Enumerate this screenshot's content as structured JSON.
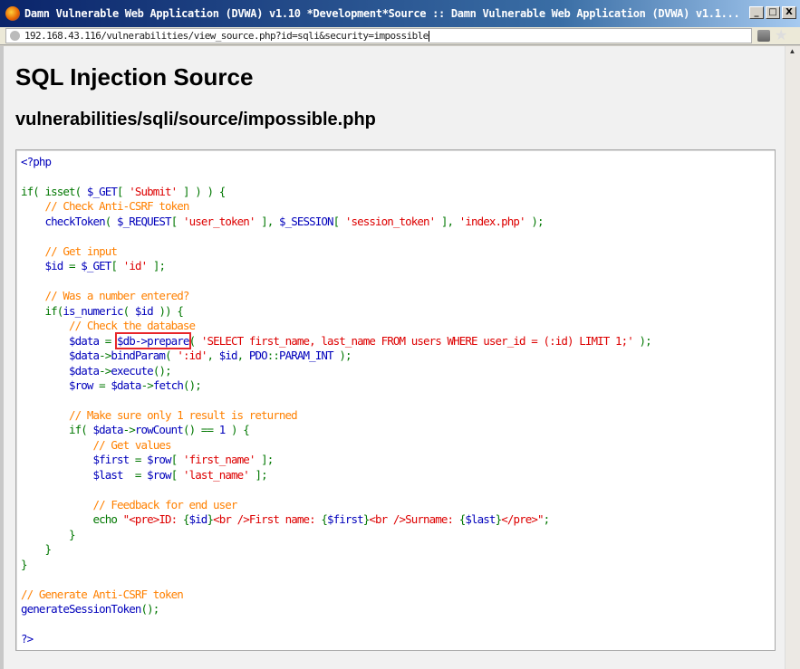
{
  "window": {
    "title": "Damn Vulnerable Web Application (DVWA) v1.10 *Development*Source :: Damn Vulnerable Web Application (DVWA) v1.1...",
    "minimize": "_",
    "maximize": "□",
    "close": "X"
  },
  "address_bar": {
    "url": "192.168.43.116/vulnerabilities/view_source.php?id=sqli&security=impossible"
  },
  "page": {
    "title": "SQL Injection Source",
    "subtitle": "vulnerabilities/sqli/source/impossible.php"
  },
  "colors": {
    "keyword": "#007700",
    "variable": "#0000bb",
    "string": "#dd0000",
    "comment": "#ff8000",
    "highlight_box": "#e8262a"
  },
  "code_lines": [
    [
      [
        "v",
        "<?php"
      ]
    ],
    [],
    [
      [
        "k",
        "if( isset( "
      ],
      [
        "v",
        "$_GET"
      ],
      [
        "k",
        "[ "
      ],
      [
        "s",
        "'Submit'"
      ],
      [
        "k",
        " ] ) ) {"
      ]
    ],
    [
      [
        "k",
        "    "
      ],
      [
        "c",
        "// Check Anti-CSRF token"
      ]
    ],
    [
      [
        "k",
        "    "
      ],
      [
        "v",
        "checkToken"
      ],
      [
        "k",
        "( "
      ],
      [
        "v",
        "$_REQUEST"
      ],
      [
        "k",
        "[ "
      ],
      [
        "s",
        "'user_token'"
      ],
      [
        "k",
        " ], "
      ],
      [
        "v",
        "$_SESSION"
      ],
      [
        "k",
        "[ "
      ],
      [
        "s",
        "'session_token'"
      ],
      [
        "k",
        " ], "
      ],
      [
        "s",
        "'index.php'"
      ],
      [
        "k",
        " );"
      ]
    ],
    [],
    [
      [
        "k",
        "    "
      ],
      [
        "c",
        "// Get input"
      ]
    ],
    [
      [
        "k",
        "    "
      ],
      [
        "v",
        "$id "
      ],
      [
        "k",
        "= "
      ],
      [
        "v",
        "$_GET"
      ],
      [
        "k",
        "[ "
      ],
      [
        "s",
        "'id'"
      ],
      [
        "k",
        " ];"
      ]
    ],
    [],
    [
      [
        "k",
        "    "
      ],
      [
        "c",
        "// Was a number entered?"
      ]
    ],
    [
      [
        "k",
        "    if("
      ],
      [
        "v",
        "is_numeric"
      ],
      [
        "k",
        "( "
      ],
      [
        "v",
        "$id "
      ],
      [
        "k",
        ")) {"
      ]
    ],
    [
      [
        "k",
        "        "
      ],
      [
        "c",
        "// Check the database"
      ]
    ],
    [
      [
        "k",
        "        "
      ],
      [
        "v",
        "$data "
      ],
      [
        "k",
        "= "
      ],
      [
        "hl",
        "$db->prepare"
      ],
      [
        "k",
        "( "
      ],
      [
        "s",
        "'SELECT first_name, last_name FROM users WHERE user_id = (:id) LIMIT 1;'"
      ],
      [
        "k",
        " );"
      ]
    ],
    [
      [
        "k",
        "        "
      ],
      [
        "v",
        "$data"
      ],
      [
        "k",
        "->"
      ],
      [
        "v",
        "bindParam"
      ],
      [
        "k",
        "( "
      ],
      [
        "s",
        "':id'"
      ],
      [
        "k",
        ", "
      ],
      [
        "v",
        "$id"
      ],
      [
        "k",
        ", "
      ],
      [
        "v",
        "PDO"
      ],
      [
        "k",
        "::"
      ],
      [
        "v",
        "PARAM_INT "
      ],
      [
        "k",
        ");"
      ]
    ],
    [
      [
        "k",
        "        "
      ],
      [
        "v",
        "$data"
      ],
      [
        "k",
        "->"
      ],
      [
        "v",
        "execute"
      ],
      [
        "k",
        "();"
      ]
    ],
    [
      [
        "k",
        "        "
      ],
      [
        "v",
        "$row "
      ],
      [
        "k",
        "= "
      ],
      [
        "v",
        "$data"
      ],
      [
        "k",
        "->"
      ],
      [
        "v",
        "fetch"
      ],
      [
        "k",
        "();"
      ]
    ],
    [],
    [
      [
        "k",
        "        "
      ],
      [
        "c",
        "// Make sure only 1 result is returned"
      ]
    ],
    [
      [
        "k",
        "        if( "
      ],
      [
        "v",
        "$data"
      ],
      [
        "k",
        "->"
      ],
      [
        "v",
        "rowCount"
      ],
      [
        "k",
        "() == "
      ],
      [
        "v",
        "1 "
      ],
      [
        "k",
        ") {"
      ]
    ],
    [
      [
        "k",
        "            "
      ],
      [
        "c",
        "// Get values"
      ]
    ],
    [
      [
        "k",
        "            "
      ],
      [
        "v",
        "$first "
      ],
      [
        "k",
        "= "
      ],
      [
        "v",
        "$row"
      ],
      [
        "k",
        "[ "
      ],
      [
        "s",
        "'first_name'"
      ],
      [
        "k",
        " ];"
      ]
    ],
    [
      [
        "k",
        "            "
      ],
      [
        "v",
        "$last  "
      ],
      [
        "k",
        "= "
      ],
      [
        "v",
        "$row"
      ],
      [
        "k",
        "[ "
      ],
      [
        "s",
        "'last_name'"
      ],
      [
        "k",
        " ];"
      ]
    ],
    [],
    [
      [
        "k",
        "            "
      ],
      [
        "c",
        "// Feedback for end user"
      ]
    ],
    [
      [
        "k",
        "            echo "
      ],
      [
        "s",
        "\"<pre>ID: "
      ],
      [
        "k",
        "{"
      ],
      [
        "v",
        "$id"
      ],
      [
        "k",
        "}"
      ],
      [
        "s",
        "<br />First name: "
      ],
      [
        "k",
        "{"
      ],
      [
        "v",
        "$first"
      ],
      [
        "k",
        "}"
      ],
      [
        "s",
        "<br />Surname: "
      ],
      [
        "k",
        "{"
      ],
      [
        "v",
        "$last"
      ],
      [
        "k",
        "}"
      ],
      [
        "s",
        "</pre>\""
      ],
      [
        "k",
        ";"
      ]
    ],
    [
      [
        "k",
        "        }"
      ]
    ],
    [
      [
        "k",
        "    }"
      ]
    ],
    [
      [
        "k",
        "}"
      ]
    ],
    [],
    [
      [
        "c",
        "// Generate Anti-CSRF token"
      ]
    ],
    [
      [
        "v",
        "generateSessionToken"
      ],
      [
        "k",
        "();"
      ]
    ],
    [],
    [
      [
        "v",
        "?>"
      ]
    ]
  ]
}
